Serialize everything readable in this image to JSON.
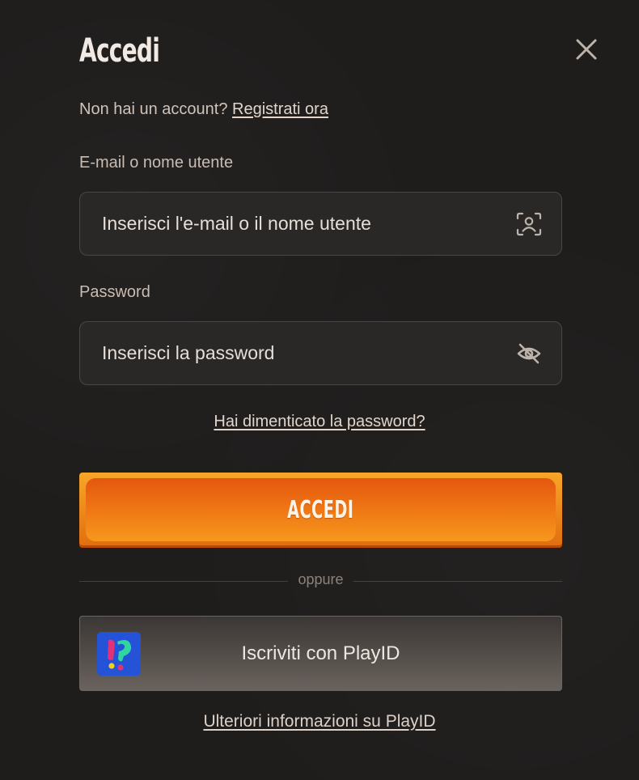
{
  "dialog": {
    "title": "Accedi",
    "signup_prompt": "Non hai un account?",
    "signup_link": "Registrati ora"
  },
  "email_field": {
    "label": "E-mail o nome utente",
    "placeholder": "Inserisci l'e-mail o il nome utente",
    "value": "",
    "icon": "face-scan-icon"
  },
  "password_field": {
    "label": "Password",
    "placeholder": "Inserisci la password",
    "value": "",
    "icon": "eye-off-icon"
  },
  "forgot_password": "Hai dimenticato la password?",
  "login_button": "ACCEDI",
  "divider_text": "oppure",
  "playid": {
    "button_label": "Iscriviti con PlayID",
    "info_link": "Ulteriori informazioni su PlayID",
    "icon": "playid-logo-icon"
  },
  "colors": {
    "background": "#1f1d1c",
    "accent_orange": "#ee7414",
    "field_background": "#2a2826",
    "playid_blue": "#2453d8"
  }
}
